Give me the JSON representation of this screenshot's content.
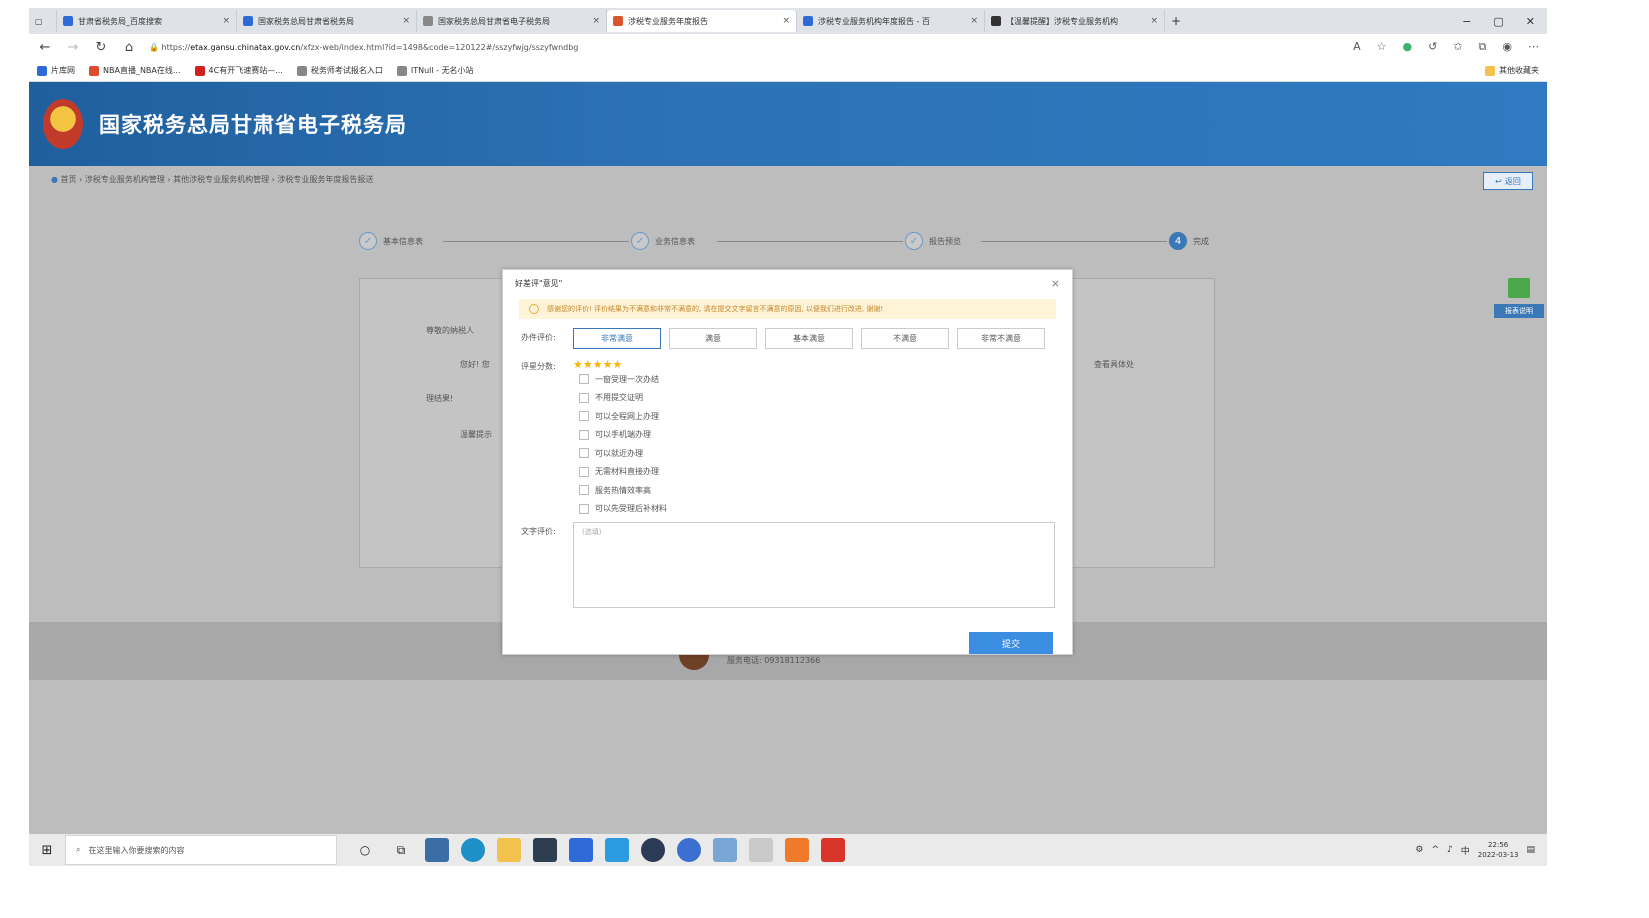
{
  "browser": {
    "tabs": [
      {
        "title": "甘肃省税务局_百度搜索",
        "color": "#2f6bd8",
        "active": false
      },
      {
        "title": "国家税务总局甘肃省税务局",
        "color": "#2f6bd8",
        "active": false
      },
      {
        "title": "国家税务总局甘肃省电子税务局",
        "color": "#888888",
        "active": false
      },
      {
        "title": "涉税专业服务年度报告",
        "color": "#d9552b",
        "active": true
      },
      {
        "title": "涉税专业服务机构年度报告 - 百",
        "color": "#2f6bd8",
        "active": false
      },
      {
        "title": "【温馨提醒】涉税专业服务机构",
        "color": "#333333",
        "active": false
      }
    ],
    "new_tab": "+",
    "window_controls": [
      "−",
      "▢",
      "✕"
    ],
    "url_prefix": "https://",
    "url_host": "etax.gansu.chinatax.gov.cn",
    "url_path": "/xfzx-web/index.html?id=1498&code=120122#/sszyfwjg/sszyfwndbg",
    "bookmarks": [
      {
        "label": "片库网",
        "color": "#2f6bd8"
      },
      {
        "label": "NBA直播_NBA在线...",
        "color": "#e04b2b"
      },
      {
        "label": "4C有开飞速赛站—...",
        "color": "#d02020"
      },
      {
        "label": "税务师考试报名入口",
        "color": "#888888"
      },
      {
        "label": "ITNull - 无名小站",
        "color": "#888888"
      }
    ],
    "bookmarks_right": "其他收藏夹"
  },
  "site": {
    "title": "国家税务总局甘肃省电子税务局",
    "breadcrumb": "首页 › 涉税专业服务机构管理 › 其他涉税专业服务机构管理 › 涉税专业服务年度报告报送",
    "back_label": "返回",
    "help_label": "报表说明"
  },
  "steps": [
    {
      "label": "基本信息表",
      "icon": "✓",
      "current": false
    },
    {
      "label": "业务信息表",
      "icon": "✓",
      "current": false
    },
    {
      "label": "报告预览",
      "icon": "✓",
      "current": false
    },
    {
      "label": "完成",
      "icon": "4",
      "current": true
    }
  ],
  "panel": {
    "line1": "尊敬的纳税人",
    "line2": "您好! 您",
    "line2_tail": "查看具体处",
    "line3": "理结果!",
    "line4": "温馨提示"
  },
  "modal": {
    "title": "好差评\"意见\"",
    "close": "×",
    "notice": "感谢您的评价! 评价结果为不满意和非常不满意的, 请在提交文字留言不满意的原因, 以便我们进行改进, 谢谢!",
    "rating_label": "办件评价:",
    "rating_options": [
      "非常满意",
      "满意",
      "基本满意",
      "不满意",
      "非常不满意"
    ],
    "selected_index": 0,
    "score_label": "评星分数:",
    "stars": "★★★★★",
    "checklist": [
      "一窗受理一次办结",
      "不用提交证明",
      "可以全程网上办理",
      "可以手机端办理",
      "可以就近办理",
      "无需材料直接办理",
      "服务热情效率高",
      "可以先受理后补材料"
    ],
    "text_label": "文字评价:",
    "text_placeholder": "(选填)",
    "submit_label": "提交"
  },
  "footer": {
    "phone": "服务电话: 09318112366"
  },
  "taskbar": {
    "search_placeholder": "在这里输入你要搜索的内容",
    "time": "22:56",
    "date": "2022-03-13",
    "tray": "中"
  }
}
